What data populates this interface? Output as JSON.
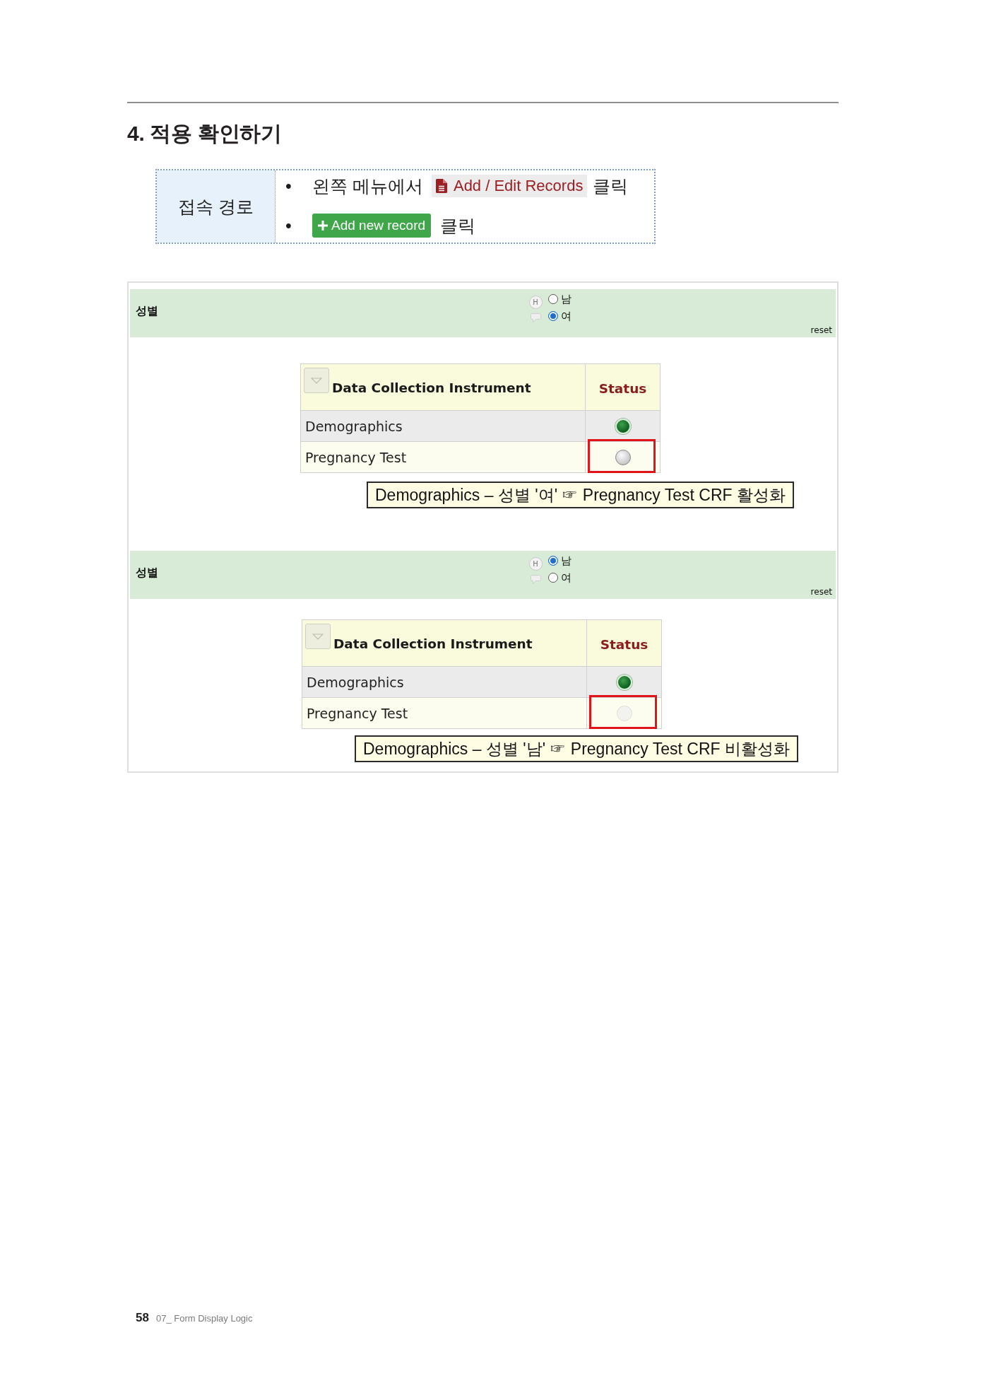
{
  "heading": "4. 적용 확인하기",
  "access_path": {
    "label": "접속 경로",
    "steps": [
      {
        "kind": "link",
        "bullet": "•",
        "before": "왼쪽 메뉴에서",
        "control": "Add / Edit Records",
        "after": "클릭"
      },
      {
        "kind": "button",
        "bullet": "•",
        "control": "Add new record",
        "after": "클릭"
      }
    ]
  },
  "screens": [
    {
      "field": {
        "label": "성별",
        "history": "H",
        "options": [
          {
            "label": "남",
            "selected": false
          },
          {
            "label": "여",
            "selected": true
          }
        ],
        "reset": "reset"
      },
      "table": {
        "columns": [
          "Data Collection Instrument",
          "Status"
        ],
        "rows": [
          {
            "name": "Demographics",
            "complete": true,
            "enabled": true,
            "highlighted": false
          },
          {
            "name": "Pregnancy Test",
            "complete": false,
            "enabled": true,
            "highlighted": true
          }
        ]
      },
      "callout": "Demographics – 성별 '여' ☞ Pregnancy Test CRF 활성화"
    },
    {
      "field": {
        "label": "성별",
        "history": "H",
        "options": [
          {
            "label": "남",
            "selected": true
          },
          {
            "label": "여",
            "selected": false
          }
        ],
        "reset": "reset"
      },
      "table": {
        "columns": [
          "Data Collection Instrument",
          "Status"
        ],
        "rows": [
          {
            "name": "Demographics",
            "complete": true,
            "enabled": true,
            "highlighted": false
          },
          {
            "name": "Pregnancy Test",
            "complete": false,
            "enabled": false,
            "highlighted": true
          }
        ]
      },
      "callout": "Demographics – 성별 '남' ☞ Pregnancy Test CRF 비활성화"
    }
  ],
  "footer": {
    "page_number": "58",
    "chapter": "07_ Form Display Logic"
  }
}
